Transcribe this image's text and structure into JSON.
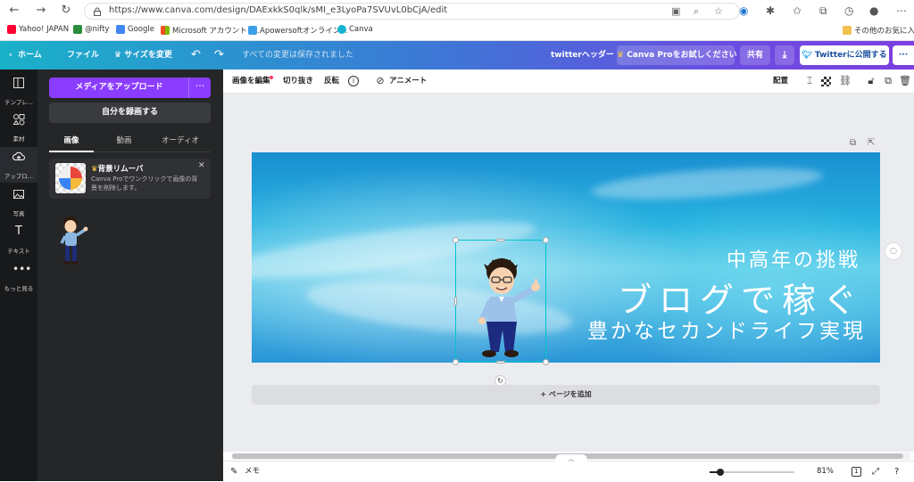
{
  "browser": {
    "url": "https://www.canva.com/design/DAExkkS0qlk/sMI_e3LyoPa7SVUvL0bCjA/edit",
    "bookmarks": [
      "Yahoo! JAPAN",
      "@nifty",
      "Google",
      "Microsoft アカウント |...",
      "Apowersoftオンライン...",
      "Canva"
    ],
    "other_bookmarks": "その他のお気に入り"
  },
  "topbar": {
    "home": "ホーム",
    "file": "ファイル",
    "resize": "サイズを変更",
    "saved_status": "すべての変更は保存されました",
    "doc_title": "twitterヘッダー",
    "try_pro": "Canva Proをお試しください",
    "share": "共有",
    "publish": "Twitterに公開する",
    "more": "···"
  },
  "leftrail": {
    "items": [
      {
        "label": "テンプレ...",
        "icon": "template-icon"
      },
      {
        "label": "素材",
        "icon": "elements-icon"
      },
      {
        "label": "アップロ...",
        "icon": "upload-icon"
      },
      {
        "label": "写真",
        "icon": "photo-icon"
      },
      {
        "label": "テキスト",
        "icon": "text-icon"
      },
      {
        "label": "もっと見る",
        "icon": "more-icon"
      }
    ]
  },
  "panel": {
    "upload_button": "メディアをアップロード",
    "upload_more": "···",
    "record_button": "自分を録画する",
    "tabs": [
      "画像",
      "動画",
      "オーディオ"
    ],
    "bg_remover": {
      "title": "背景リムーバ",
      "desc": "Canva Proでワンクリックで画像の背景を削除します。",
      "close": "✕"
    }
  },
  "edbar": {
    "edit_image": "画像を編集",
    "crop": "切り抜き",
    "flip": "反転",
    "animate": "アニメート",
    "arrange": "配置"
  },
  "design": {
    "line1": "中高年の挑戦",
    "line2": "ブログで稼ぐ",
    "line3": "豊かなセカンドライフ実現"
  },
  "canvas": {
    "add_page": "+ ページを追加"
  },
  "bottombar": {
    "notes": "メモ",
    "zoom": "81%",
    "page_count": "1"
  },
  "colors": {
    "accent_purple": "#8b3dff",
    "selection": "#00c4cc"
  }
}
